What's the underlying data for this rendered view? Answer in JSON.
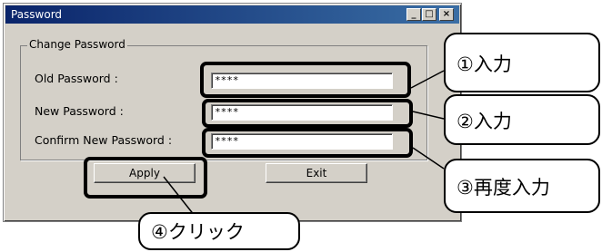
{
  "window": {
    "title": "Password",
    "minimize_glyph": "_",
    "maximize_glyph": "□",
    "close_glyph": "×"
  },
  "group": {
    "label": "Change Password"
  },
  "fields": {
    "old_label": "Old Password :",
    "old_value": "****",
    "new_label": "New Password :",
    "new_value": "****",
    "confirm_label": "Confirm New Password :",
    "confirm_value": "****"
  },
  "buttons": {
    "apply": "Apply",
    "exit": "Exit"
  },
  "callouts": {
    "step1": "①入力",
    "step2": "②入力",
    "step3": "③再度入力",
    "step4": "④クリック"
  }
}
